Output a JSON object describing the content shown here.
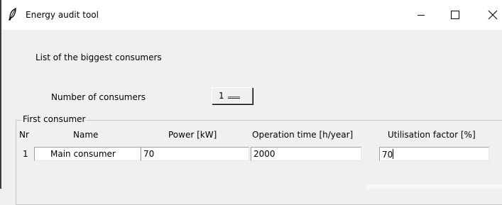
{
  "window": {
    "title": "Energy audit tool",
    "app_icon": "feather-icon",
    "controls": [
      "minimize-icon",
      "maximize-icon",
      "close-icon"
    ]
  },
  "main": {
    "heading": "List of the biggest consumers",
    "count_label": "Number of consumers",
    "count_value": "1"
  },
  "group": {
    "title": "First consumer",
    "headers": {
      "nr": "Nr",
      "name": "Name",
      "power": "Power [kW]",
      "operation_time": "Operation time [h/year]",
      "utilisation": "Utilisation factor [%]"
    },
    "row": {
      "nr": "1",
      "name": "Main consumer",
      "power": "70",
      "operation_time": "2000",
      "utilisation": "70"
    }
  }
}
